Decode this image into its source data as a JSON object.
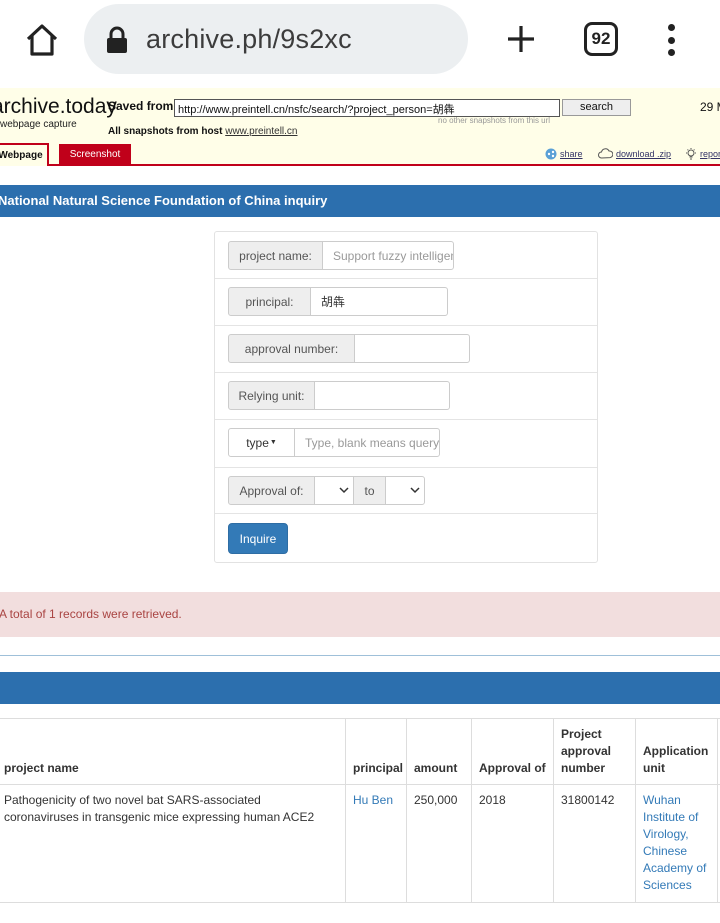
{
  "browser": {
    "url": "archive.ph/9s2xc",
    "tab_count": "92"
  },
  "archive": {
    "brand": "archive.today",
    "brand_sub": "webpage capture",
    "saved_from_label": "Saved from",
    "saved_from_url": "http://www.preintell.cn/nsfc/search/?project_person=胡犇",
    "search_label": "search",
    "date_text": "29 M",
    "no_other_note": "no other snapshots from this url",
    "all_snapshots_label": "All snapshots  from host",
    "host": "www.preintell.cn",
    "tabs": {
      "webpage": "Webpage",
      "screenshot": "Screenshot"
    },
    "actions": {
      "share": "share",
      "download": "download .zip",
      "report": "report"
    }
  },
  "page_title": "National Natural Science Foundation of China inquiry",
  "form": {
    "project_name_label": "project name:",
    "project_name_placeholder": "Support fuzzy intelligent",
    "principal_label": "principal:",
    "principal_value": "胡犇",
    "approval_number_label": "approval number:",
    "approval_number_value": "",
    "relying_unit_label": "Relying unit:",
    "relying_unit_value": "",
    "type_label": "type",
    "type_placeholder": "Type, blank means query all",
    "approval_of_label": "Approval of:",
    "to_label": "to",
    "inquire_label": "Inquire"
  },
  "alert_text": "A total of 1 records were retrieved.",
  "table": {
    "headers": {
      "project_name": "project name",
      "principal": "principal",
      "amount": "amount",
      "approval_of": "Approval of",
      "project_approval_number": [
        "Project",
        "approval",
        "number"
      ],
      "application_unit": [
        "Application",
        "unit"
      ]
    },
    "rows": [
      {
        "project_name": [
          "Pathogenicity of two novel bat SARS-associated",
          "coronaviruses in transgenic mice expressing human ACE2"
        ],
        "principal": "Hu Ben",
        "amount": "250,000",
        "approval_of": "2018",
        "project_approval_number": "31800142",
        "application_unit": [
          "Wuhan",
          "Institute of",
          "Virology,",
          "Chinese",
          "Academy of",
          "Sciences"
        ]
      }
    ]
  }
}
